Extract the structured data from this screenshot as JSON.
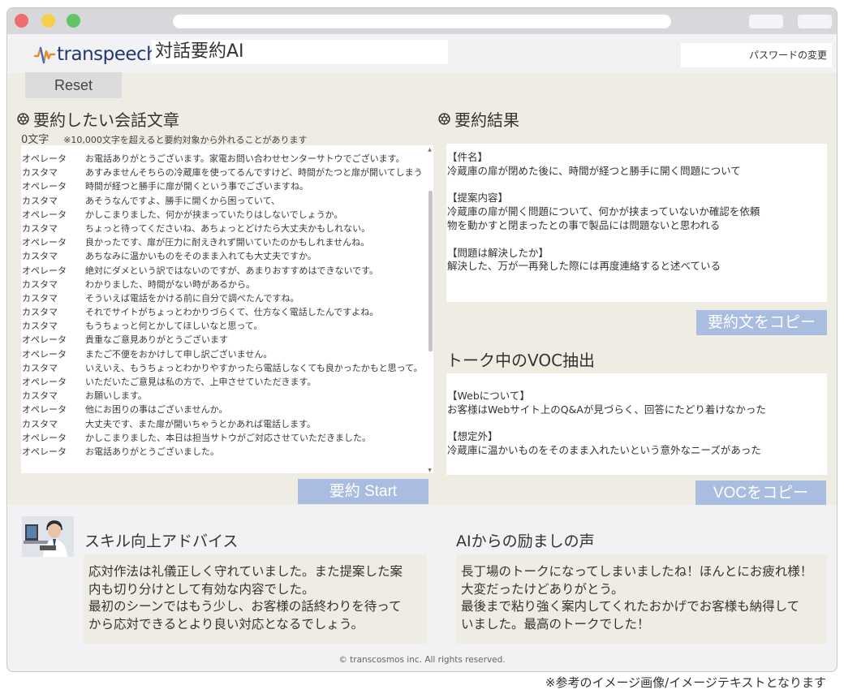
{
  "app": {
    "brand": "transpeech",
    "title": "対話要約AI",
    "password_change": "パスワードの変更",
    "reset_label": "Reset"
  },
  "conversation": {
    "title": "要約したい会話文章",
    "char_count": "0文字",
    "char_note": "※10,000文字を超えると要約対象から外れることがあります",
    "lines": [
      {
        "speaker": "オペレータ",
        "text": "お電話ありがとうございます。家電お問い合わせセンターサトウでございます。"
      },
      {
        "speaker": "カスタマ",
        "text": "あすみませんそちらの冷蔵庫を使ってるんですけど、時間がたつと扉が開いてしまう"
      },
      {
        "speaker": "オペレータ",
        "text": "時間が経つと勝手に扉が開くという事でございますね。"
      },
      {
        "speaker": "カスタマ",
        "text": "あそうなんですよ、勝手に開くから困っていて、"
      },
      {
        "speaker": "オペレータ",
        "text": "かしこまりました、何かが挟まっていたりはしないでしょうか。"
      },
      {
        "speaker": "カスタマ",
        "text": "ちょっと待ってくださいね、あちょっとどけたら大丈夫かもしれない。"
      },
      {
        "speaker": "オペレータ",
        "text": "良かったです、扉が圧力に耐えきれず開いていたのかもしれませんね。"
      },
      {
        "speaker": "カスタマ",
        "text": "あちなみに温かいものをそのまま入れても大丈夫ですか。"
      },
      {
        "speaker": "オペレータ",
        "text": "絶対にダメという訳ではないのですが、あまりおすすめはできないです。"
      },
      {
        "speaker": "カスタマ",
        "text": "わかりました、時間がない時があるから。"
      },
      {
        "speaker": "カスタマ",
        "text": "そういえば電話をかける前に自分で調べたんですね。"
      },
      {
        "speaker": "カスタマ",
        "text": "それでサイトがちょっとわかりづらくて、仕方なく電話したんですよね。"
      },
      {
        "speaker": "カスタマ",
        "text": "もうちょっと何とかしてほしいなと思って。"
      },
      {
        "speaker": "オペレータ",
        "text": "貴重なご意見ありがとうございます"
      },
      {
        "speaker": "オペレータ",
        "text": "またご不便をおかけして申し訳ございません。"
      },
      {
        "speaker": "カスタマ",
        "text": "いえいえ、もうちょっとわかりやすかったら電話しなくても良かったかもと思って。"
      },
      {
        "speaker": "オペレータ",
        "text": "いただいたご意見は私の方で、上申させていただきます。"
      },
      {
        "speaker": "カスタマ",
        "text": "お願いします。"
      },
      {
        "speaker": "オペレータ",
        "text": "他にお困りの事はございませんか。"
      },
      {
        "speaker": "カスタマ",
        "text": "大丈夫です、また扉が開いちゃうとかあれば電話します。"
      },
      {
        "speaker": "オペレータ",
        "text": "かしこまりました、本日は担当サトウがご対応させていただきました。"
      },
      {
        "speaker": "オペレータ",
        "text": "お電話ありがとうございました。"
      }
    ],
    "start_label": "要約 Start"
  },
  "summary": {
    "title": "要約結果",
    "subject_heading": "【件名】",
    "subject_text": "冷蔵庫の扉が閉めた後に、時間が経つと勝手に開く問題について",
    "proposal_heading": "【提案内容】",
    "proposal_line1": "冷蔵庫の扉が開く問題について、何かが挟まっていないか確認を依頼",
    "proposal_line2": "物を動かすと閉まったとの事で製品には問題ないと思われる",
    "resolved_heading": "【問題は解決したか】",
    "resolved_text": "解決した、万が一再発した際には再度連絡すると述べている",
    "copy_label": "要約文をコピー"
  },
  "voc": {
    "title": "トーク中のVOC抽出",
    "web_heading": "【Webについて】",
    "web_text": "お客様はWebサイト上のQ&Aが見づらく、回答にたどり着けなかった",
    "unexpected_heading": "【想定外】",
    "unexpected_text": "冷蔵庫に温かいものをそのまま入れたいという意外なニーズがあった",
    "copy_label": "VOCをコピー"
  },
  "advice": {
    "title": "スキル向上アドバイス",
    "lines": [
      "応対作法は礼儀正しく守れていました。また提案した案",
      "内も切り分けとして有効な内容でした。",
      "最初のシーンではもう少し、お客様の話終わりを待って",
      "から応対できるとより良い対応となるでしょう。"
    ]
  },
  "encouragement": {
    "title": "AIからの励ましの声",
    "lines": [
      "長丁場のトークになってしまいましたね！ほんとにお疲れ様！",
      "大変だったけどありがとう。",
      "最後まで粘り強く案内してくれたおかげでお客様も納得して",
      "いました。最高のトークでした！"
    ]
  },
  "footer": {
    "copyright": "© transcosmos inc. All rights reserved."
  },
  "disclaimer": "※参考のイメージ画像/イメージテキストとなります",
  "colors": {
    "accent_button": "#a8bde0",
    "panel_bg": "#efede3",
    "brand_text": "#22386e"
  }
}
